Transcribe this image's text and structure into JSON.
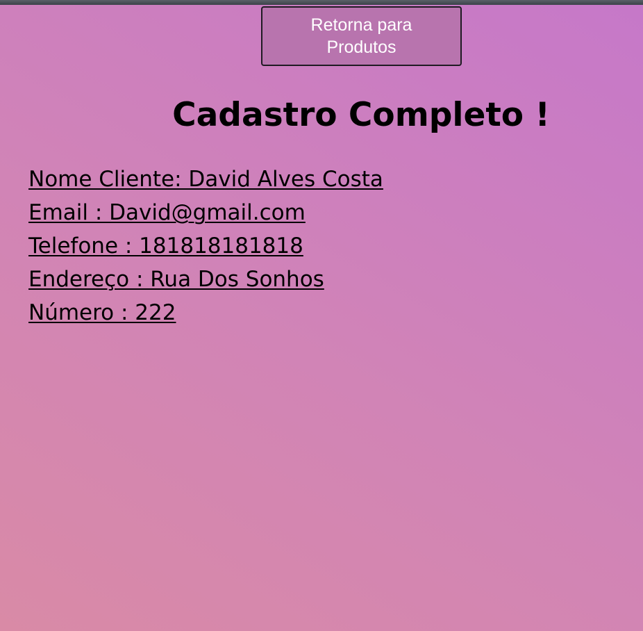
{
  "back_button": {
    "label": "Retorna para Produtos"
  },
  "title": "Cadastro Completo !",
  "details": [
    "Nome Cliente: David Alves Costa",
    "Email : David@gmail.com",
    "Telefone : 181818181818",
    "Endereço : Rua Dos Sonhos",
    "Número : 222"
  ],
  "colors": {
    "background_start": "#d98aa6",
    "background_end": "#c678c9",
    "button_fill": "#b874ae",
    "button_text": "#ffffff",
    "text": "#000000"
  }
}
